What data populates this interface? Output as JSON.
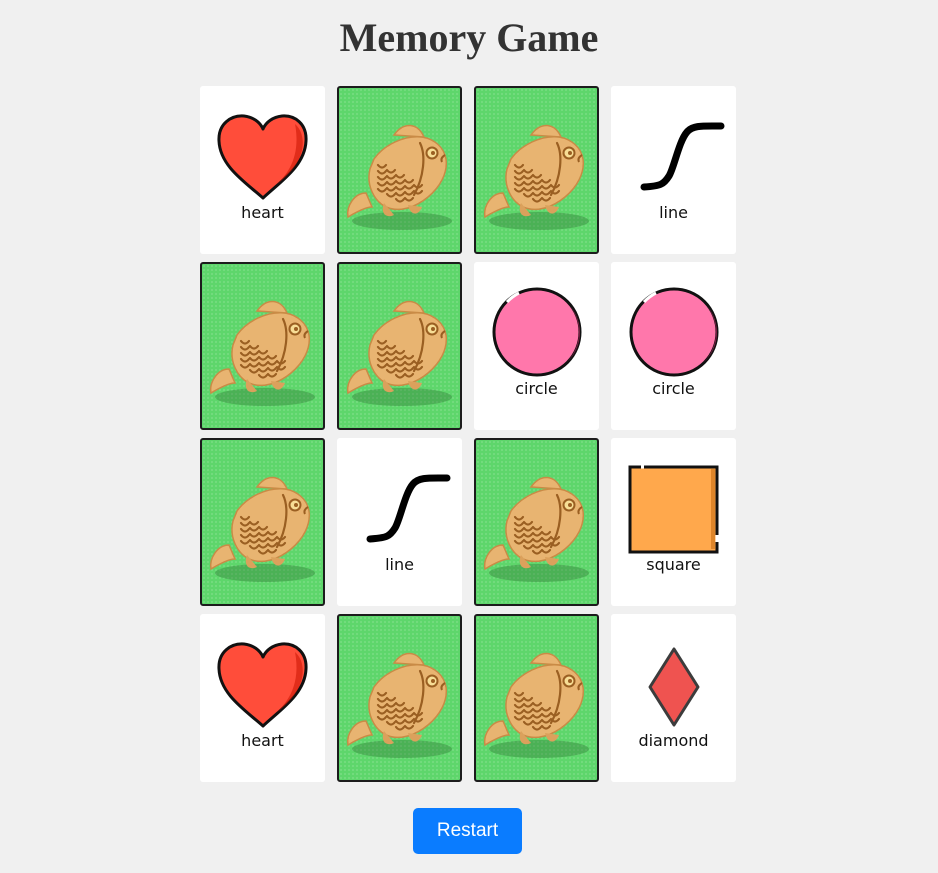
{
  "title": "Memory Game",
  "restart_label": "Restart",
  "card_back_icon": "taiyaki-fish-icon",
  "colors": {
    "background": "#f0f0f0",
    "card_back": "#5ed66b",
    "heart": "#ff4d3a",
    "circle": "#ff77ab",
    "square": "#ffa84c",
    "diamond": "#ef5350",
    "button": "#0a7cff"
  },
  "board": {
    "columns": 4,
    "rows": 4,
    "cards": [
      {
        "state": "face-up",
        "symbol": "heart",
        "label": "heart"
      },
      {
        "state": "face-down"
      },
      {
        "state": "face-down"
      },
      {
        "state": "face-up",
        "symbol": "line",
        "label": "line"
      },
      {
        "state": "face-down"
      },
      {
        "state": "face-down"
      },
      {
        "state": "face-up",
        "symbol": "circle",
        "label": "circle"
      },
      {
        "state": "face-up",
        "symbol": "circle",
        "label": "circle"
      },
      {
        "state": "face-down"
      },
      {
        "state": "face-up",
        "symbol": "line",
        "label": "line"
      },
      {
        "state": "face-down"
      },
      {
        "state": "face-up",
        "symbol": "square",
        "label": "square"
      },
      {
        "state": "face-up",
        "symbol": "heart",
        "label": "heart"
      },
      {
        "state": "face-down"
      },
      {
        "state": "face-down"
      },
      {
        "state": "face-up",
        "symbol": "diamond",
        "label": "diamond"
      }
    ]
  }
}
